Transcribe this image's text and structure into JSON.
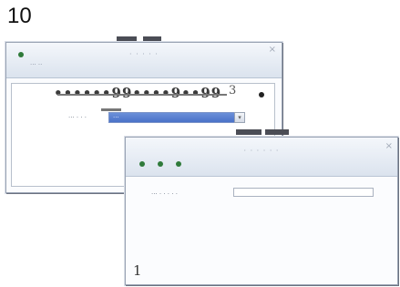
{
  "page": {
    "number": "10",
    "footer_number": "1"
  },
  "window_back": {
    "title": "· · · · ·",
    "close": "×",
    "app_label": "··· ··",
    "scribble": "••••••99••••9••99",
    "side_value": "3",
    "field": {
      "label": "··· · · ·",
      "selected": "···"
    }
  },
  "window_front": {
    "title": "· · · · · ·",
    "close": "×",
    "field": {
      "label": "··· · · · · ·",
      "value": ""
    }
  },
  "icons": {
    "dropdown": "chevron-down-icon",
    "close": "close-icon"
  }
}
